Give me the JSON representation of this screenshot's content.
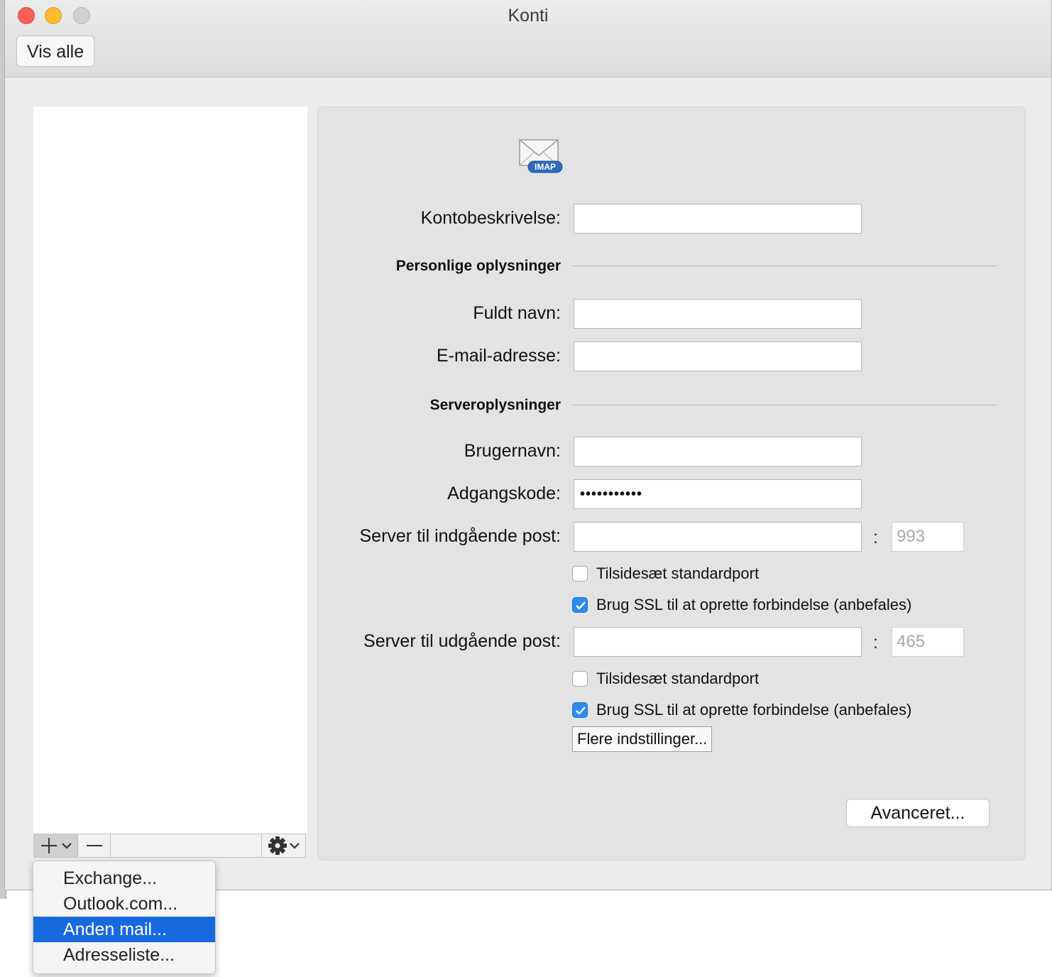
{
  "window": {
    "title": "Konti",
    "show_all_label": "Vis alle"
  },
  "account_form": {
    "icon": "imap-mail-icon",
    "icon_badge": "IMAP",
    "account_description_label": "Kontobeskrivelse:",
    "account_description_value": "",
    "personal_section": "Personlige oplysninger",
    "full_name_label": "Fuldt navn:",
    "full_name_value": "",
    "email_label": "E-mail-adresse:",
    "email_value": "",
    "server_section": "Serveroplysninger",
    "username_label": "Brugernavn:",
    "username_value": "",
    "password_label": "Adgangskode:",
    "password_value": "•••••••••••",
    "incoming_label": "Server til indgående post:",
    "incoming_value": "",
    "incoming_port": "993",
    "incoming_override_port_label": "Tilsidesæt standardport",
    "incoming_override_port_checked": false,
    "incoming_ssl_label": "Brug SSL til at oprette forbindelse (anbefales)",
    "incoming_ssl_checked": true,
    "outgoing_label": "Server til udgående post:",
    "outgoing_value": "",
    "outgoing_port": "465",
    "outgoing_override_port_label": "Tilsidesæt standardport",
    "outgoing_override_port_checked": false,
    "outgoing_ssl_label": "Brug SSL til at oprette forbindelse (anbefales)",
    "outgoing_ssl_checked": true,
    "more_settings_label": "Flere indstillinger...",
    "advanced_label": "Avanceret..."
  },
  "list_toolbar": {
    "add_icon": "plus-icon",
    "remove_icon": "minus-icon",
    "gear_icon": "gear-icon"
  },
  "add_menu": {
    "items": [
      {
        "label": "Exchange..."
      },
      {
        "label": "Outlook.com..."
      },
      {
        "label": "Anden mail..."
      },
      {
        "label": "Adresseliste..."
      }
    ],
    "selected_index": 2
  },
  "colors": {
    "accent": "#1769e0",
    "checkbox_checked": "#2d8bf0",
    "window_bg": "#ececec",
    "panel_bg": "#e3e3e3"
  }
}
